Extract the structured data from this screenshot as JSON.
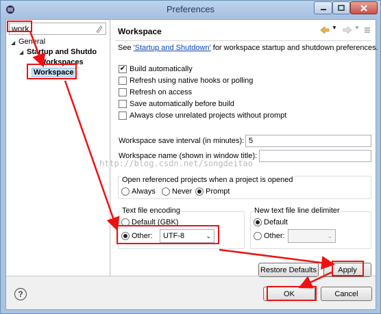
{
  "window": {
    "title": "Preferences"
  },
  "filter": {
    "value": "work"
  },
  "tree": {
    "general": "General",
    "startup": "Startup and Shutdo",
    "workspaces": "Workspaces",
    "workspace": "Workspace"
  },
  "page": {
    "title": "Workspace",
    "desc_prefix": "See ",
    "desc_link": "'Startup and Shutdown'",
    "desc_suffix": " for workspace startup and shutdown preferences."
  },
  "options": {
    "build": "Build automatically",
    "refresh_native": "Refresh using native hooks or polling",
    "refresh_access": "Refresh on access",
    "save_auto": "Save automatically before build",
    "close_unrelated": "Always close unrelated projects without prompt"
  },
  "checked": {
    "build": true,
    "refresh_native": false,
    "refresh_access": false,
    "save_auto": false,
    "close_unrelated": false
  },
  "fields": {
    "save_interval_label": "Workspace save interval (in minutes):",
    "save_interval_value": "5",
    "ws_name_label": "Workspace name (shown in window title):",
    "ws_name_value": ""
  },
  "open_ref": {
    "title": "Open referenced projects when a project is opened",
    "always": "Always",
    "never": "Never",
    "prompt": "Prompt",
    "selected": "prompt"
  },
  "encoding": {
    "title": "Text file encoding",
    "default": "Default (GBK)",
    "other": "Other:",
    "other_value": "UTF-8",
    "selected": "other"
  },
  "delimiter": {
    "title": "New text file line delimiter",
    "default": "Default",
    "other": "Other:",
    "other_value": "",
    "selected": "default"
  },
  "buttons": {
    "restore": "Restore Defaults",
    "apply": "Apply",
    "ok": "OK",
    "cancel": "Cancel"
  },
  "watermark": "http://blog.csdn.net/songdeitao",
  "colors": {
    "annotation": "#e11111",
    "link": "#0a44b6",
    "selection": "#cce4f7"
  },
  "icons": [
    "help-icon",
    "back-icon",
    "forward-icon",
    "clear-filter-icon",
    "close-icon"
  ]
}
